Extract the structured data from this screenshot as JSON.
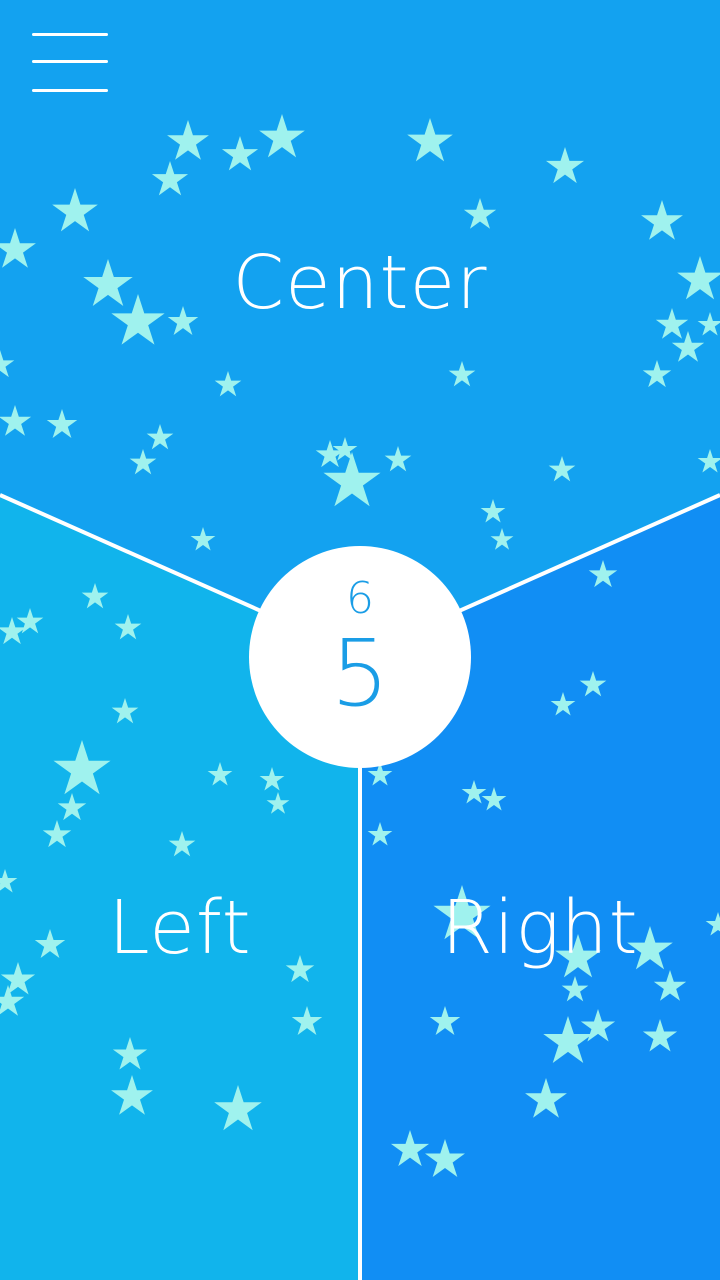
{
  "zones": {
    "center": {
      "label": "Center",
      "color": "#13a2f0"
    },
    "left": {
      "label": "Left",
      "color": "#11b4ec"
    },
    "right": {
      "label": "Right",
      "color": "#118ef4"
    }
  },
  "score": {
    "top": "6",
    "main": "5",
    "color": "#1a9de6"
  },
  "star_color": "#9ff2ee",
  "menu_icon": "hamburger-menu-icon"
}
